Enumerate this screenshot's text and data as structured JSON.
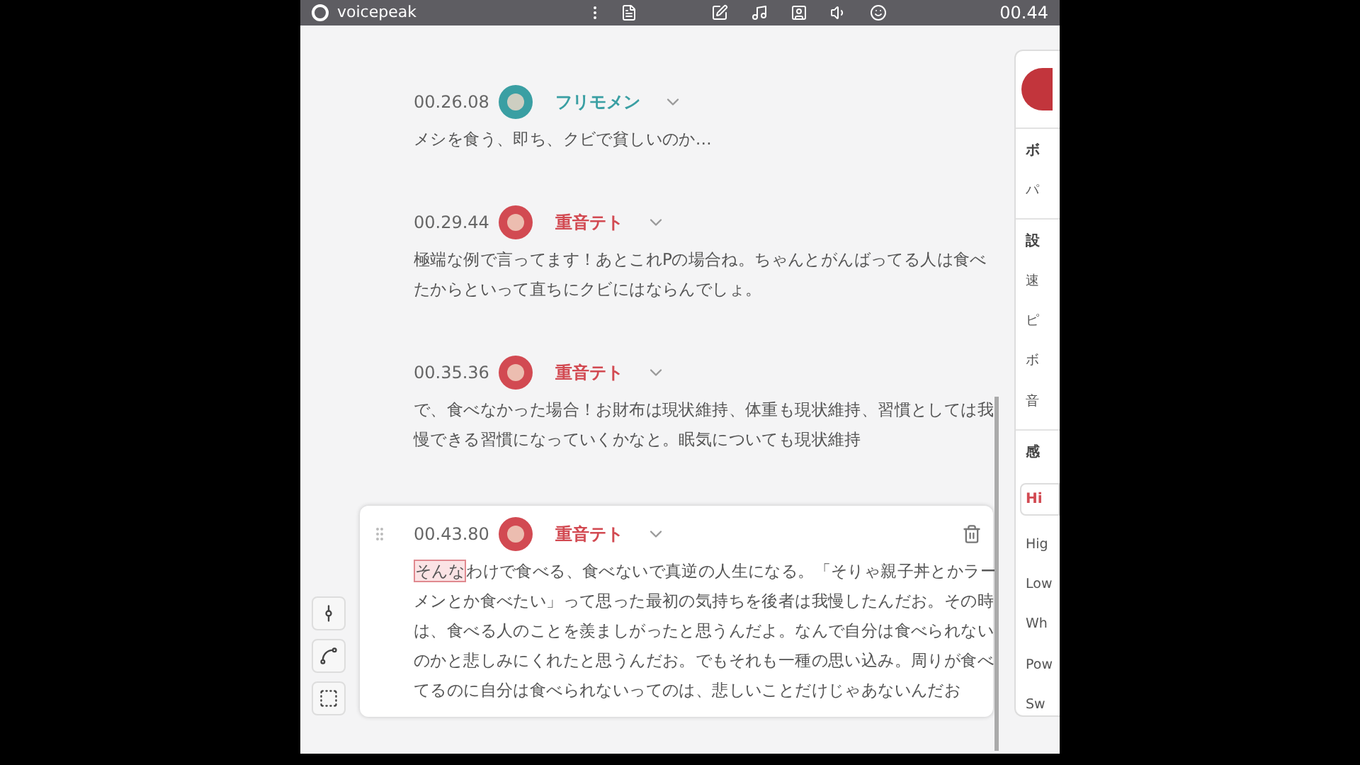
{
  "app": {
    "title": "voicepeak",
    "time": "00.44"
  },
  "lines": [
    {
      "time": "00.26.08",
      "speaker": "フリモメン",
      "color": "#3a9fa3",
      "selected": false,
      "text": "メシを食う、即ち、クビで貧しいのか…"
    },
    {
      "time": "00.29.44",
      "speaker": "重音テト",
      "color": "#d24a52",
      "selected": false,
      "text": "極端な例で言ってます！あとこれPの場合ね。ちゃんとがんばってる人は食べたからといって直ちにクビにはならんでしょ。"
    },
    {
      "time": "00.35.36",
      "speaker": "重音テト",
      "color": "#d24a52",
      "selected": false,
      "text": "で、食べなかった場合！お財布は現状維持、体重も現状維持、習慣としては我慢できる習慣になっていくかなと。眠気についても現状維持"
    },
    {
      "time": "00.43.80",
      "speaker": "重音テト",
      "color": "#d24a52",
      "selected": true,
      "highlight": "そんな",
      "text": "わけで食べる、食べないで真逆の人生になる。「そりゃ親子丼とかラーメンとか食べたい」って思った最初の気持ちを後者は我慢したんだお。その時は、食べる人のことを羨ましがったと思うんだよ。なんで自分は食べられないのかと悲しみにくれたと思うんだお。でもそれも一種の思い込み。周りが食べてるのに自分は食べられないってのは、悲しいことだけじゃあないんだお"
    }
  ],
  "panel": {
    "sections": [
      {
        "title": "ボ",
        "items": [
          "パ"
        ]
      },
      {
        "title": "設",
        "items": [
          "速",
          "ピ",
          "ボ",
          "音"
        ]
      },
      {
        "title": "感",
        "chip": "Hi",
        "items": [
          "Hig",
          "Low",
          "Wh",
          "Pow",
          "Sw"
        ]
      }
    ]
  }
}
